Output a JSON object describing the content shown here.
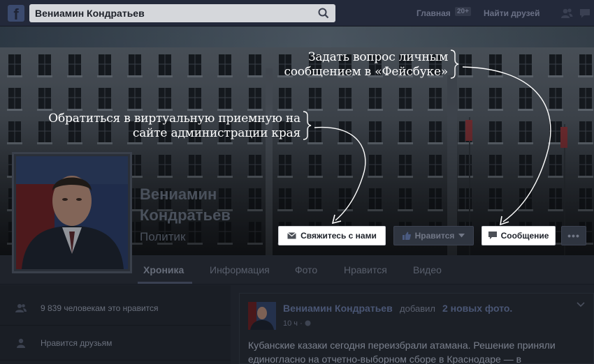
{
  "topbar": {
    "logo_letter": "f",
    "search_value": "Вениамин Кондратьев",
    "nav_home": "Главная",
    "nav_home_badge": "20+",
    "nav_friends": "Найти друзей"
  },
  "cover": {
    "annotation_message": "Задать вопрос личным сообщением в «Фейсбуке»",
    "annotation_reception": "Обратиться в виртуальную приемную на сайте администрации края"
  },
  "profile": {
    "name_line1": "Вениамин",
    "name_line2": "Кондратьев",
    "category": "Политик"
  },
  "actions": {
    "contact_label": "Свяжитесь с нами",
    "like_label": "Нравится",
    "message_label": "Сообщение",
    "more_label": "•••"
  },
  "tabs": [
    "Хроника",
    "Информация",
    "Фото",
    "Нравится",
    "Видео"
  ],
  "sidebar": {
    "likes_text": "9 839 человекам это нравится",
    "friends_text": "Нравится друзьям"
  },
  "post": {
    "author": "Вениамин Кондратьев",
    "action": "добавил",
    "photos": "2 новых фото",
    "photos_suffix": ".",
    "time": "10 ч ·",
    "text": "Кубанские казаки сегодня переизбрали атамана. Решение приняли единогласно на отчетно-выборном сборе в Краснодаре — в"
  },
  "colors": {
    "annotation": "#ffffff",
    "button_primary_bg": "#ffffff",
    "topbar_bg": "#23293a"
  }
}
